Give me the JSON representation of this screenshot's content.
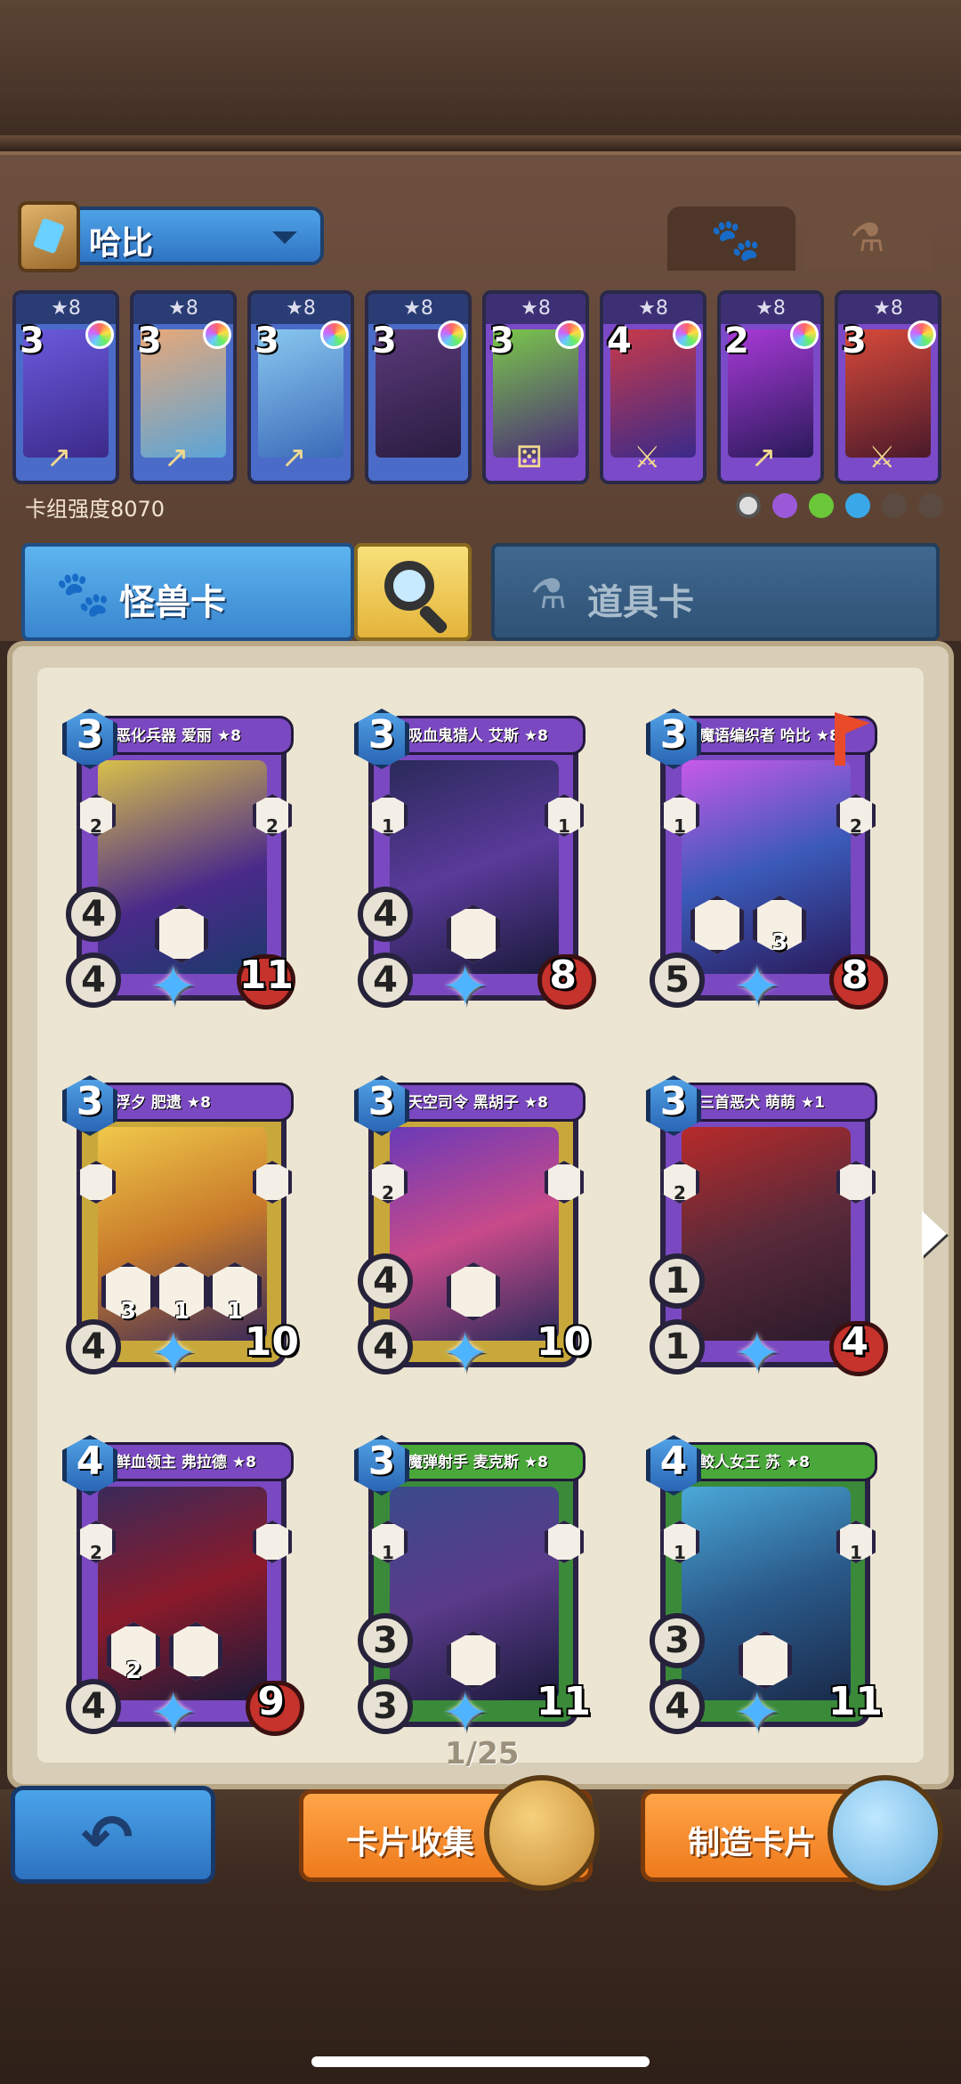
{
  "deck": {
    "name": "哈比",
    "power_label": "卡组强度8070",
    "mini_cards": [
      {
        "stars": "★8",
        "cost": "3"
      },
      {
        "stars": "★8",
        "cost": "3"
      },
      {
        "stars": "★8",
        "cost": "3"
      },
      {
        "stars": "★8",
        "cost": "3"
      },
      {
        "stars": "★8",
        "cost": "3"
      },
      {
        "stars": "★8",
        "cost": "4"
      },
      {
        "stars": "★8",
        "cost": "2"
      },
      {
        "stars": "★8",
        "cost": "3"
      }
    ]
  },
  "tabs": {
    "monster": "怪兽卡",
    "item": "道具卡"
  },
  "cards": [
    {
      "title": "恶化兵器 爱丽 ★8",
      "cost": "3",
      "left": "2",
      "right": "2",
      "atk": "4",
      "def": "4",
      "hp": "11"
    },
    {
      "title": "吸血鬼猎人 艾斯 ★8",
      "cost": "3",
      "left": "1",
      "right": "1",
      "atk": "4",
      "def": "4",
      "hp": "8"
    },
    {
      "title": "魔语编织者 哈比 ★8",
      "cost": "3",
      "left": "1",
      "right": "2",
      "atk": "5",
      "def": "",
      "hp": "8",
      "ability_sub": "3"
    },
    {
      "title": "浮夕 肥遗 ★8",
      "cost": "3",
      "left": "",
      "right": "",
      "atk": "4",
      "def": "",
      "hp": "10",
      "ability_subs": [
        "3",
        "1",
        "1"
      ]
    },
    {
      "title": "天空司令 黑胡子 ★8",
      "cost": "3",
      "left": "2",
      "right": "",
      "atk": "4",
      "def": "4",
      "hp": "10"
    },
    {
      "title": "三首恶犬 萌萌 ★1",
      "cost": "3",
      "left": "2",
      "right": "",
      "atk": "1",
      "def": "1",
      "hp": "4"
    },
    {
      "title": "鲜血领主 弗拉德 ★8",
      "cost": "4",
      "left": "2",
      "right": "",
      "atk": "4",
      "def": "",
      "hp": "9",
      "ability_sub": "2"
    },
    {
      "title": "魔弹射手 麦克斯 ★8",
      "cost": "3",
      "left": "1",
      "right": "",
      "atk": "3",
      "def": "3",
      "hp": "11"
    },
    {
      "title": "鲛人女王 苏 ★8",
      "cost": "4",
      "left": "1",
      "right": "1",
      "atk": "3",
      "def": "4",
      "hp": "11"
    }
  ],
  "page_indicator": "1/25",
  "buttons": {
    "collection": "卡片收集",
    "craft": "制造卡片"
  },
  "colors": {
    "blue_accent": "#3a86cf",
    "orange_button": "#ee7a1c",
    "parchment": "#ece5d2"
  }
}
